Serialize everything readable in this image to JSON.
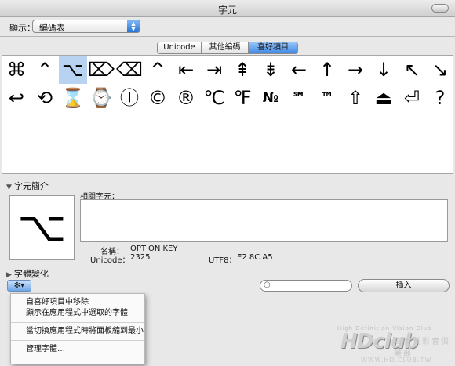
{
  "window": {
    "title": "字元"
  },
  "toolbar": {
    "show_label": "顯示：",
    "view_select_value": "編碼表"
  },
  "tabs": [
    {
      "label": "Unicode"
    },
    {
      "label": "其他編碼"
    },
    {
      "label": "喜好項目"
    }
  ],
  "characters": [
    "⌘",
    "⌃",
    "⌥",
    "⌦",
    "⌫",
    "^",
    "⇤",
    "⇥",
    "⇞",
    "⇟",
    "←",
    "↑",
    "→",
    "↓",
    "↖",
    "↘",
    "↩",
    "⟲",
    "⌛",
    "⌚",
    "Ⓘ",
    "©",
    "®",
    "℃",
    "℉",
    "№",
    "℠",
    "™",
    "⇧",
    "⏏",
    "⏎",
    "?"
  ],
  "info": {
    "section_label": "字元簡介",
    "preview_char": "⌥",
    "related_label": "相關字元：",
    "name_label": "名稱：",
    "name_value": "OPTION KEY",
    "unicode_label": "Unicode：",
    "unicode_value": "2325",
    "utf8_label": "UTF8：",
    "utf8_value": "E2 8C A5"
  },
  "font_variation": {
    "label": "字體變化"
  },
  "actions": {
    "gear_label": "✻▾",
    "insert_label": "插入",
    "search_placeholder": ""
  },
  "menu": {
    "items": [
      "自喜好項目中移除",
      "顯示在應用程式中選取的字體",
      "當切換應用程式時將面板縮到最小",
      "管理字體…"
    ]
  },
  "watermark": {
    "top_text": "High Definition Vision Club",
    "main_text": "HDclub",
    "cjk_text": "高畫質影音俱樂部",
    "url_text": "WWW.HD.CLUB.TW"
  }
}
